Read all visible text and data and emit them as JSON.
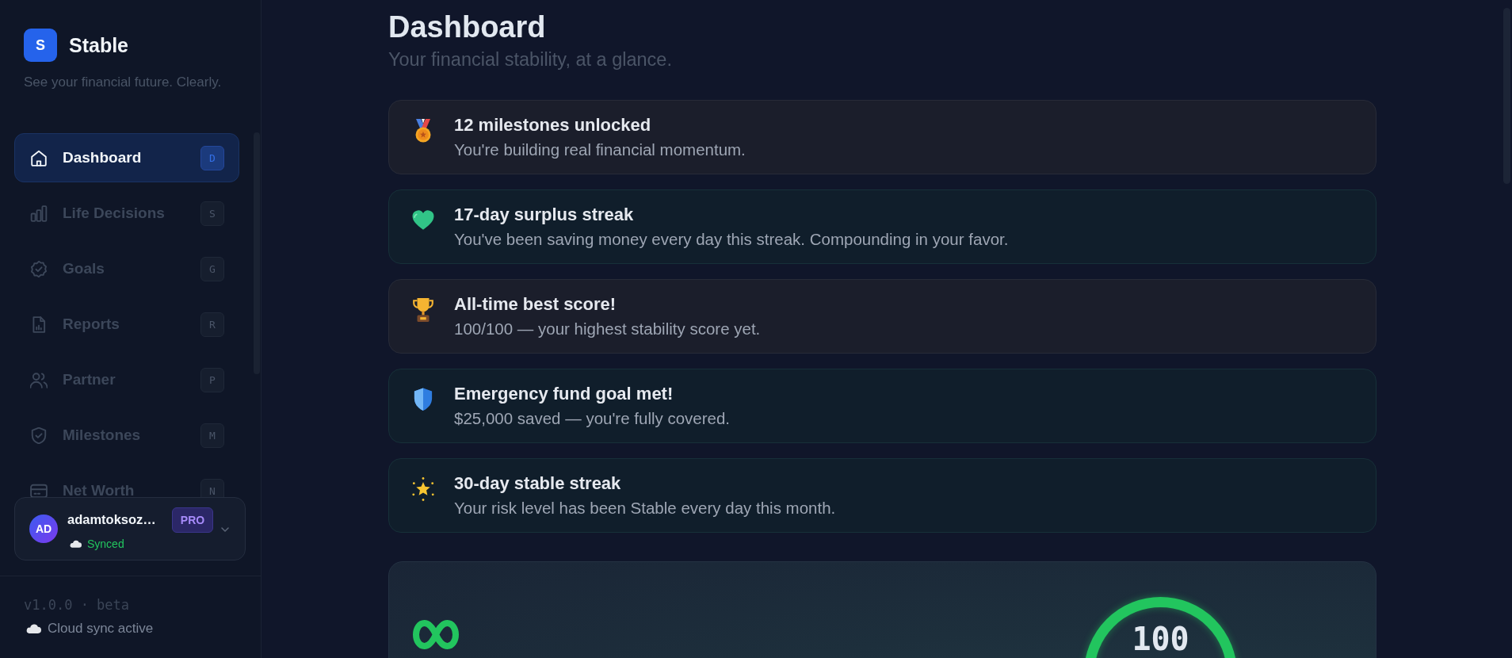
{
  "brand": {
    "logo": "S",
    "name": "Stable",
    "tagline": "See your financial future. Clearly."
  },
  "nav": [
    {
      "label": "Dashboard",
      "shortcut": "D",
      "selected": true
    },
    {
      "label": "Life Decisions",
      "shortcut": "S",
      "selected": false
    },
    {
      "label": "Goals",
      "shortcut": "G",
      "selected": false
    },
    {
      "label": "Reports",
      "shortcut": "R",
      "selected": false
    },
    {
      "label": "Partner",
      "shortcut": "P",
      "selected": false
    },
    {
      "label": "Milestones",
      "shortcut": "M",
      "selected": false
    },
    {
      "label": "Net Worth",
      "shortcut": "N",
      "selected": false
    }
  ],
  "user": {
    "initials": "AD",
    "name": "adamtoksoz…",
    "plan": "PRO",
    "status": "Synced"
  },
  "footer": {
    "version": "v1.0.0 · beta",
    "sync": "Cloud sync active"
  },
  "header": {
    "title": "Dashboard",
    "subtitle": "Your financial stability, at a glance."
  },
  "milestones": [
    {
      "title": "12 milestones unlocked",
      "description": "You're building real financial momentum.",
      "kind": "neutral"
    },
    {
      "title": "17-day surplus streak",
      "description": "You've been saving money every day this streak. Compounding in your favor.",
      "kind": "success"
    },
    {
      "title": "All-time best score!",
      "description": "100/100 — your highest stability score yet.",
      "kind": "neutral"
    },
    {
      "title": "Emergency fund goal met!",
      "description": "$25,000 saved — you're fully covered.",
      "kind": "success"
    },
    {
      "title": "30-day stable streak",
      "description": "Your risk level has been Stable every day this month.",
      "kind": "success"
    }
  ],
  "score_panel": {
    "score": "100"
  }
}
